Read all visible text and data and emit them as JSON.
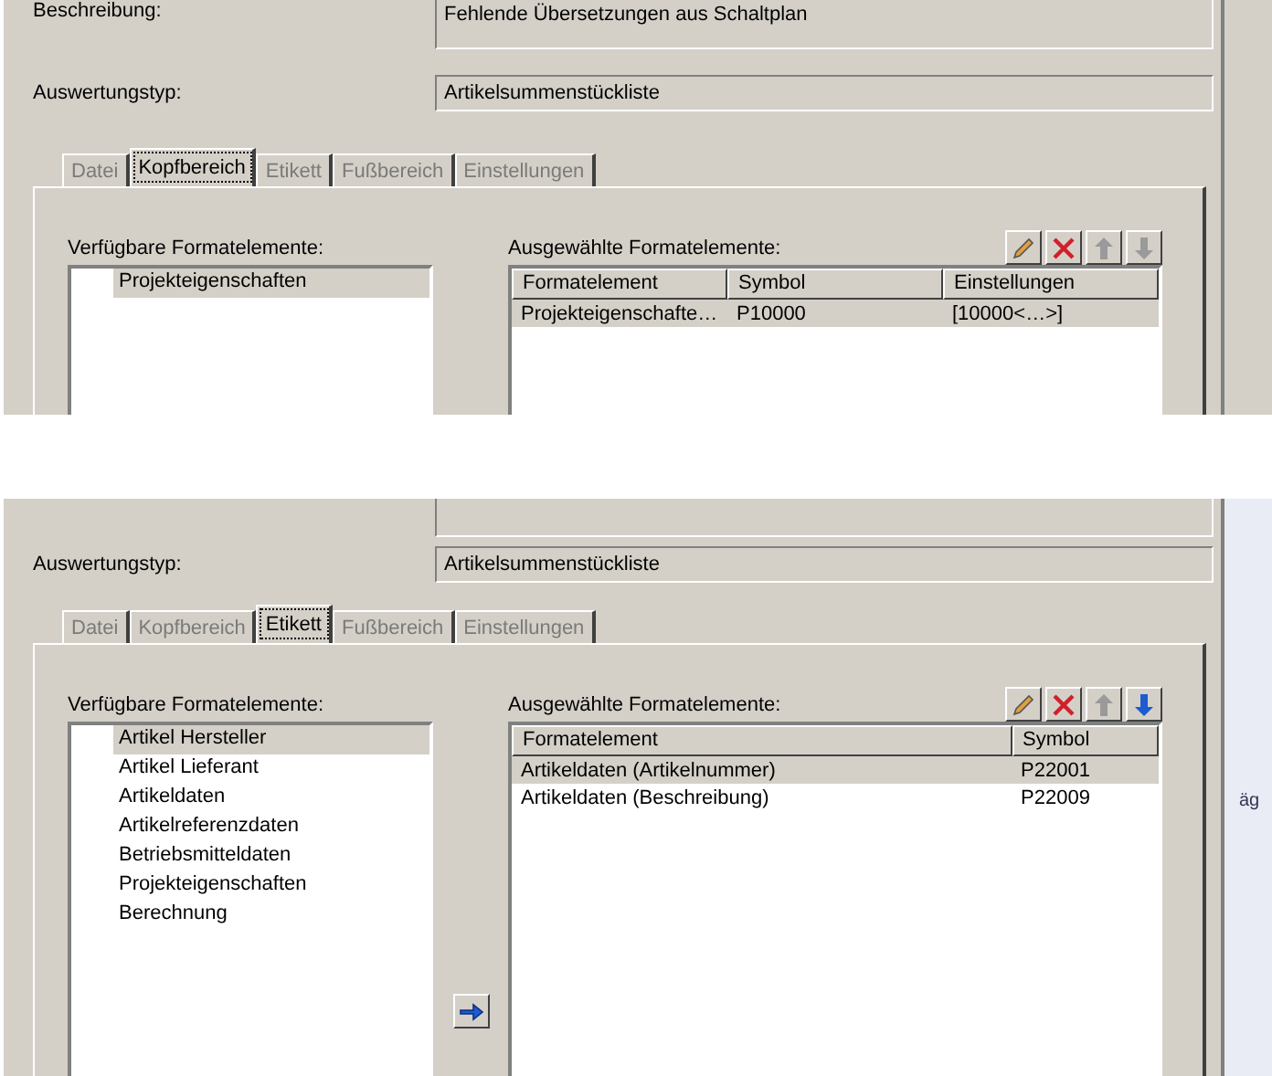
{
  "panels": [
    {
      "description": {
        "label": "Beschreibung:",
        "value": "Fehlende Übersetzungen aus Schaltplan"
      },
      "type_label": "Auswertungstyp:",
      "type_value": "Artikelsummenstückliste",
      "tabs": [
        {
          "label": "Datei",
          "selected": false
        },
        {
          "label": "Kopfbereich",
          "selected": true
        },
        {
          "label": "Etikett",
          "selected": false
        },
        {
          "label": "Fußbereich",
          "selected": false
        },
        {
          "label": "Einstellungen",
          "selected": false
        }
      ],
      "available_label": "Verfügbare Formatelemente:",
      "available": [
        {
          "label": "Projekteigenschaften",
          "selected": true
        }
      ],
      "selected_label": "Ausgewählte Formatelemente:",
      "toolbar": [
        {
          "kind": "edit",
          "disabled": false
        },
        {
          "kind": "delete",
          "disabled": false
        },
        {
          "kind": "up",
          "disabled": true
        },
        {
          "kind": "down",
          "disabled": true
        }
      ],
      "columns": [
        "Formatelement",
        "Symbol",
        "Einstellungen"
      ],
      "rows": [
        {
          "cells": [
            "Projekteigenschafte…",
            "P10000",
            "[10000<…>]"
          ],
          "selected": true
        }
      ]
    },
    {
      "type_label": "Auswertungstyp:",
      "type_value": "Artikelsummenstückliste",
      "tabs": [
        {
          "label": "Datei",
          "selected": false
        },
        {
          "label": "Kopfbereich",
          "selected": false
        },
        {
          "label": "Etikett",
          "selected": true
        },
        {
          "label": "Fußbereich",
          "selected": false
        },
        {
          "label": "Einstellungen",
          "selected": false
        }
      ],
      "available_label": "Verfügbare Formatelemente:",
      "available": [
        {
          "label": "Artikel Hersteller",
          "selected": true
        },
        {
          "label": "Artikel Lieferant",
          "selected": false
        },
        {
          "label": "Artikeldaten",
          "selected": false
        },
        {
          "label": "Artikelreferenzdaten",
          "selected": false
        },
        {
          "label": "Betriebsmitteldaten",
          "selected": false
        },
        {
          "label": "Projekteigenschaften",
          "selected": false
        },
        {
          "label": "Berechnung",
          "selected": false
        }
      ],
      "selected_label": "Ausgewählte Formatelemente:",
      "toolbar": [
        {
          "kind": "edit",
          "disabled": false
        },
        {
          "kind": "delete",
          "disabled": false
        },
        {
          "kind": "up",
          "disabled": true
        },
        {
          "kind": "down",
          "disabled": false
        }
      ],
      "columns": [
        "Formatelement",
        "Symbol"
      ],
      "rows": [
        {
          "cells": [
            "Artikeldaten (Artikelnummer)",
            "P22001"
          ],
          "selected": true
        },
        {
          "cells": [
            "Artikeldaten (Beschreibung)",
            "P22009"
          ],
          "selected": false
        }
      ],
      "add_button": true,
      "side_text": "äg"
    }
  ]
}
